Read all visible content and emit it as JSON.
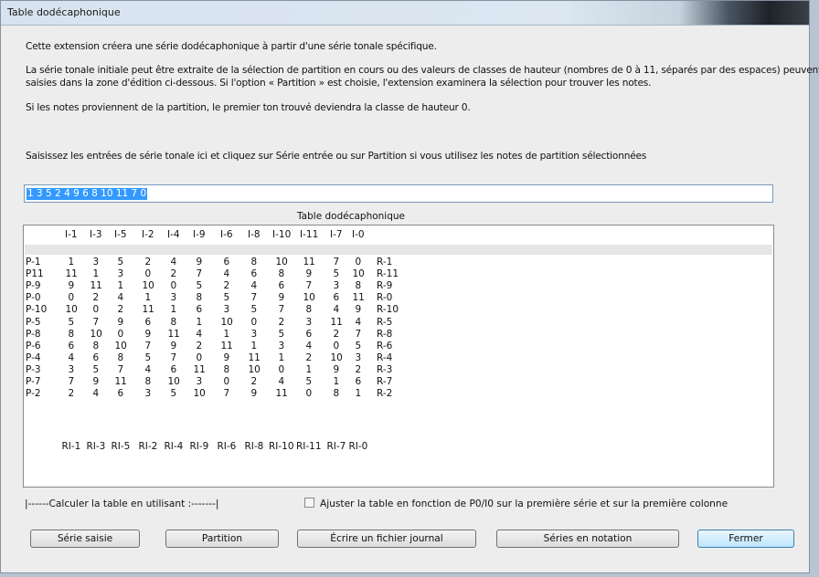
{
  "window": {
    "title": "Table dodécaphonique"
  },
  "intro": {
    "line1": "Cette extension créera une série dodécaphonique à partir d'une série tonale spécifique.",
    "line2": "La série tonale initiale peut être extraite de la sélection de partition en cours ou des valeurs de classes de hauteur (nombres de 0 à 11, séparés par des espaces) peuvent être",
    "line3": "saisies dans la zone d'édition ci-dessous. Si l'option « Partition » est choisie, l'extension examinera la sélection pour trouver les notes.",
    "line4": "Si les notes proviennent de la partition, le premier ton trouvé deviendra la classe de hauteur 0.",
    "line5": "Saisissez les entrées de série tonale ici et cliquez sur Série entrée ou sur Partition si vous utilisez les notes de partition sélectionnées"
  },
  "series_input": {
    "value": "1 3 5 2 4 9 6 8 10 11 7 0"
  },
  "table": {
    "title": "Table dodécaphonique",
    "top_headers": [
      "I-1",
      "I-3",
      "I-5",
      "I-2",
      "I-4",
      "I-9",
      "I-6",
      "I-8",
      "I-10",
      "I-11",
      "I-7",
      "I-0"
    ],
    "bottom_headers": [
      "RI-1",
      "RI-3",
      "RI-5",
      "RI-2",
      "RI-4",
      "RI-9",
      "RI-6",
      "RI-8",
      "RI-10",
      "RI-11",
      "RI-7",
      "RI-0"
    ],
    "rows": [
      {
        "p": "P-1",
        "cells": [
          "1",
          "3",
          "5",
          "2",
          "4",
          "9",
          "6",
          "8",
          "10",
          "11",
          "7",
          "0"
        ],
        "r": "R-1"
      },
      {
        "p": "P11",
        "cells": [
          "11",
          "1",
          "3",
          "0",
          "2",
          "7",
          "4",
          "6",
          "8",
          "9",
          "5",
          "10"
        ],
        "r": "R-11"
      },
      {
        "p": "P-9",
        "cells": [
          "9",
          "11",
          "1",
          "10",
          "0",
          "5",
          "2",
          "4",
          "6",
          "7",
          "3",
          "8"
        ],
        "r": "R-9"
      },
      {
        "p": "P-0",
        "cells": [
          "0",
          "2",
          "4",
          "1",
          "3",
          "8",
          "5",
          "7",
          "9",
          "10",
          "6",
          "11"
        ],
        "r": "R-0"
      },
      {
        "p": "P-10",
        "cells": [
          "10",
          "0",
          "2",
          "11",
          "1",
          "6",
          "3",
          "5",
          "7",
          "8",
          "4",
          "9"
        ],
        "r": "R-10"
      },
      {
        "p": "P-5",
        "cells": [
          "5",
          "7",
          "9",
          "6",
          "8",
          "1",
          "10",
          "0",
          "2",
          "3",
          "11",
          "4"
        ],
        "r": "R-5"
      },
      {
        "p": "P-8",
        "cells": [
          "8",
          "10",
          "0",
          "9",
          "11",
          "4",
          "1",
          "3",
          "5",
          "6",
          "2",
          "7"
        ],
        "r": "R-8"
      },
      {
        "p": "P-6",
        "cells": [
          "6",
          "8",
          "10",
          "7",
          "9",
          "2",
          "11",
          "1",
          "3",
          "4",
          "0",
          "5"
        ],
        "r": "R-6"
      },
      {
        "p": "P-4",
        "cells": [
          "4",
          "6",
          "8",
          "5",
          "7",
          "0",
          "9",
          "11",
          "1",
          "2",
          "10",
          "3"
        ],
        "r": "R-4"
      },
      {
        "p": "P-3",
        "cells": [
          "3",
          "5",
          "7",
          "4",
          "6",
          "11",
          "8",
          "10",
          "0",
          "1",
          "9",
          "2"
        ],
        "r": "R-3"
      },
      {
        "p": "P-7",
        "cells": [
          "7",
          "9",
          "11",
          "8",
          "10",
          "3",
          "0",
          "2",
          "4",
          "5",
          "1",
          "6"
        ],
        "r": "R-7"
      },
      {
        "p": "P-2",
        "cells": [
          "2",
          "4",
          "6",
          "3",
          "5",
          "10",
          "7",
          "9",
          "11",
          "0",
          "8",
          "1"
        ],
        "r": "R-2"
      }
    ]
  },
  "footer": {
    "compute_label": "|------Calculer la table en utilisant :-------|",
    "adjust_checkbox": {
      "label": "Ajuster la table en fonction de P0/I0 sur la première série et sur la première colonne",
      "checked": false
    }
  },
  "buttons": {
    "serie_saisie": "Série saisie",
    "partition": "Partition",
    "journal": "Écrire un fichier journal",
    "notation": "Séries en notation",
    "fermer": "Fermer"
  }
}
